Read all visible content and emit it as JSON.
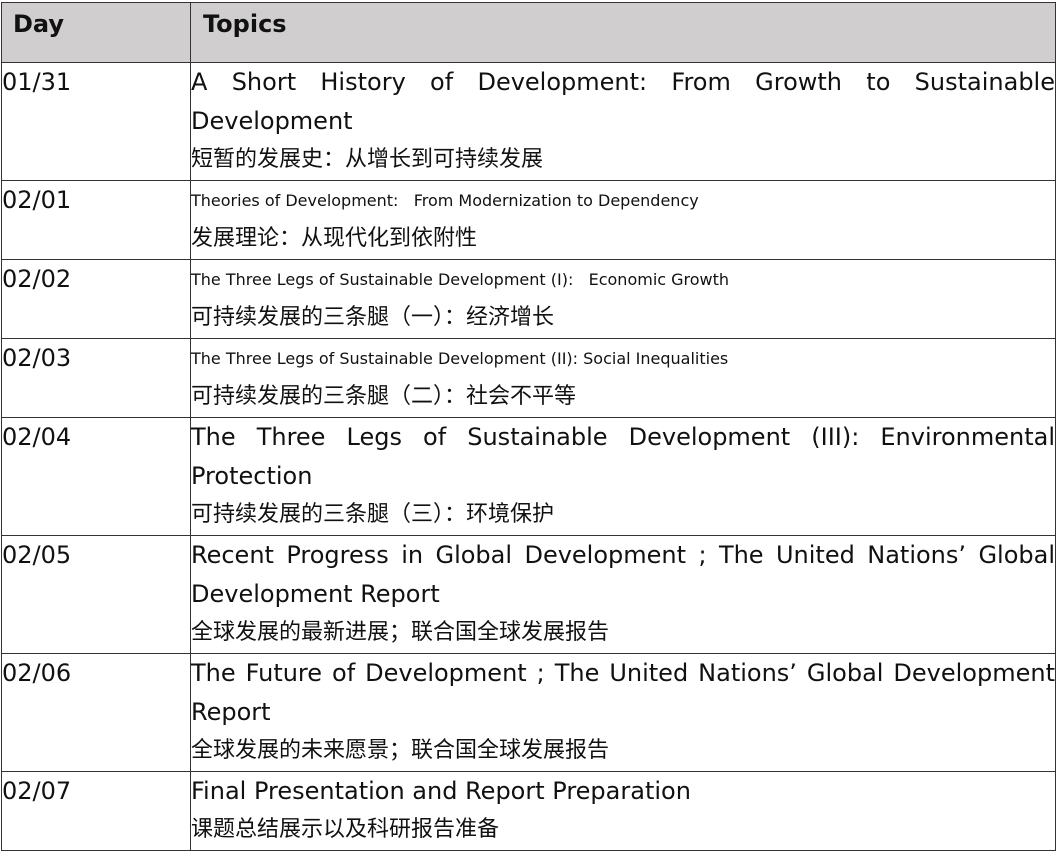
{
  "table": {
    "headers": {
      "day": "Day",
      "topics": "Topics"
    },
    "rows": [
      {
        "day": "01/31",
        "topic_en": "A Short History of Development: From Growth to Sustainable Development",
        "topic_zh": "短暂的发展史：从增长到可持续发展"
      },
      {
        "day": "02/01",
        "topic_en": "Theories of Development:   From Modernization to Dependency",
        "topic_zh": "发展理论：从现代化到依附性"
      },
      {
        "day": "02/02",
        "topic_en": "The Three Legs of Sustainable Development (I):   Economic Growth",
        "topic_zh": "可持续发展的三条腿（一）：经济增长"
      },
      {
        "day": "02/03",
        "topic_en": "The Three Legs of Sustainable Development (II): Social Inequalities",
        "topic_zh": "可持续发展的三条腿（二）：社会不平等"
      },
      {
        "day": "02/04",
        "topic_en": "The Three Legs of Sustainable Development (III): Environmental Protection",
        "topic_zh": "可持续发展的三条腿（三）：环境保护"
      },
      {
        "day": "02/05",
        "topic_en": "Recent Progress in Global Development ; The United Nations’ Global Development Report",
        "topic_zh": "全球发展的最新进展；联合国全球发展报告"
      },
      {
        "day": "02/06",
        "topic_en": "The Future of Development ; The United Nations’  Global Development Report",
        "topic_zh": "全球发展的未来愿景；联合国全球发展报告"
      },
      {
        "day": "02/07",
        "topic_en": "Final Presentation and Report Preparation",
        "topic_zh": "课题总结展示以及科研报告准备"
      }
    ]
  },
  "colors": {
    "header_bg": "#d0cece",
    "border": "#333333",
    "text": "#111111"
  }
}
